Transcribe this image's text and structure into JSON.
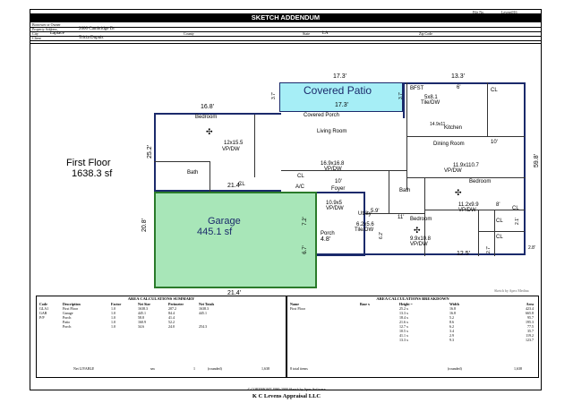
{
  "header": {
    "file_no_label": "File No.",
    "file_no_value": "Levens916",
    "title": "SKETCH ADDENDUM",
    "borrower_label": "Borrower or Owner",
    "property_address_label": "Property Address",
    "property_address_value": "2600 Cambridge Dr",
    "city_label": "City",
    "city_value": "Laplace",
    "county_label": "County",
    "state_label": "State",
    "state_value": "LA",
    "zip_label": "Zip Code",
    "client_label": "Client",
    "client_value": "Tricia Dupuis"
  },
  "sketch": {
    "first_floor_label": "First Floor",
    "first_floor_area": "1638.3 sf",
    "covered_patio_title": "Covered Patio",
    "covered_porch_label": "Covered   Porch",
    "garage_title": "Garage",
    "garage_area": "445.1 sf",
    "dims": {
      "patio_top": "17.3'",
      "patio_inner": "17.3'",
      "right_top": "13.3'",
      "bedroom_top": "16.8'",
      "garage_top": "21.4'",
      "garage_bottom": "21.4'",
      "left_side": "25.2'",
      "right_side": "59.8'",
      "garage_side": "20.8'",
      "porch_left": "7.2'",
      "porch_bottom": "4.8'",
      "porch_side": "6.7'",
      "bottom_right": "12.5'",
      "right_small_1": "2.8'",
      "right_small_2": "2.7'",
      "right_small_3": "2.1'",
      "dining_side": "10'",
      "foyer_side": "10'",
      "utility_side": "5.9'",
      "patio_side_left": "3.7'",
      "patio_side_right": "3.7'",
      "bfst_side": "6'",
      "bed2_side": "11'",
      "bed3_side": "8'",
      "bath_side": "6.2'"
    },
    "rooms": {
      "bedroom1": "Bedroom",
      "bedroom1_size": "12x15.5",
      "bedroom1_floor": "VP/DW",
      "bath1": "Bath",
      "cl1": "CL",
      "living": "Living Room",
      "living_size": "16.9x16.8",
      "living_floor": "VP/DW",
      "bfst": "BFST",
      "bfst_size": "5x8.1",
      "bfst_floor": "Tile/DW",
      "kitchen": "Kitchen",
      "kitchen_size": "14.9x11",
      "dining": "Dining Room",
      "dining_size": "11.9x110.7",
      "dining_floor": "VP/DW",
      "cl_top": "CL",
      "foyer": "Foyer",
      "bath2": "Bath",
      "bedroom2": "Bedroom",
      "bedroom2_size": "11.2x9.9",
      "bedroom2_floor": "VP/DW",
      "utility": "Utility",
      "utility_size": "10.9x5",
      "utility_floor": "VP/DW",
      "bath3_size": "6.2x5.6",
      "bath3_floor": "Tile/DW",
      "bedroom3": "Bedroom",
      "bedroom3_size": "9.9x10.8",
      "bedroom3_floor": "VP/DW",
      "ac": "A/C",
      "cl_mid": "CL",
      "porch": "Porch",
      "cl_br1": "CL",
      "cl_br2": "CL",
      "cl_r": "CL"
    },
    "credit": "Sketch by Apex Medina"
  },
  "summary": {
    "title": "AREA CALCULATIONS SUMMARY",
    "headers": [
      "Code",
      "Description",
      "Factor",
      "Net Size",
      "Perimeter",
      "Net Totals"
    ],
    "rows": [
      [
        "GLA1",
        "First Floor",
        "1.0",
        "1638.3",
        "207.2",
        "1638.3"
      ],
      [
        "GAR",
        "Garage",
        "1.0",
        "445.1",
        "84.4",
        "445.1"
      ],
      [
        "P/P",
        "Porch",
        "1.0",
        "58.8",
        "41.4",
        ""
      ],
      [
        "",
        "Patio",
        "1.0",
        "160.9",
        "52.2",
        ""
      ],
      [
        "",
        "Porch",
        "1.0",
        "34.6",
        "24.0",
        "254.3"
      ]
    ],
    "footer": [
      "Net LIVABLE",
      "(rounded)",
      "1,638"
    ],
    "footer_mid": [
      "sm",
      "1"
    ]
  },
  "breakdown": {
    "title": "AREA CALCULATIONS BREAKDOWN",
    "headers": [
      "Name",
      "Base x",
      "Height =",
      "Width",
      "Area"
    ],
    "name": "First Floor",
    "rows": [
      [
        "25.2 x",
        "16.8",
        "423.4"
      ],
      [
        "13.3 x",
        "16.8",
        "665.8"
      ],
      [
        "18.4 x",
        "5.2",
        "95.7"
      ],
      [
        "21.6 x",
        "8.6",
        "195.3"
      ],
      [
        "12.7 x",
        "6.2",
        "77.5"
      ],
      [
        "10.5 x",
        "3.4",
        "35.7"
      ],
      [
        "41.1 x",
        "2.9",
        "119.2"
      ],
      [
        "13.3 x",
        "9.3",
        "123.7"
      ]
    ],
    "footer": [
      "8 total items",
      "(rounded)",
      "1,638"
    ]
  },
  "footer": {
    "copyright": "© COPYRIGHT 1990-2000 Sketch by Apex Software",
    "company": "K C Levens Appraisal LLC"
  },
  "colors": {
    "title_bar": "#000000",
    "patio_fill": "#a6eef6",
    "garage_fill": "#a8e6b8",
    "garage_border": "#2a7a2a",
    "wall": "#1b2a6b"
  }
}
